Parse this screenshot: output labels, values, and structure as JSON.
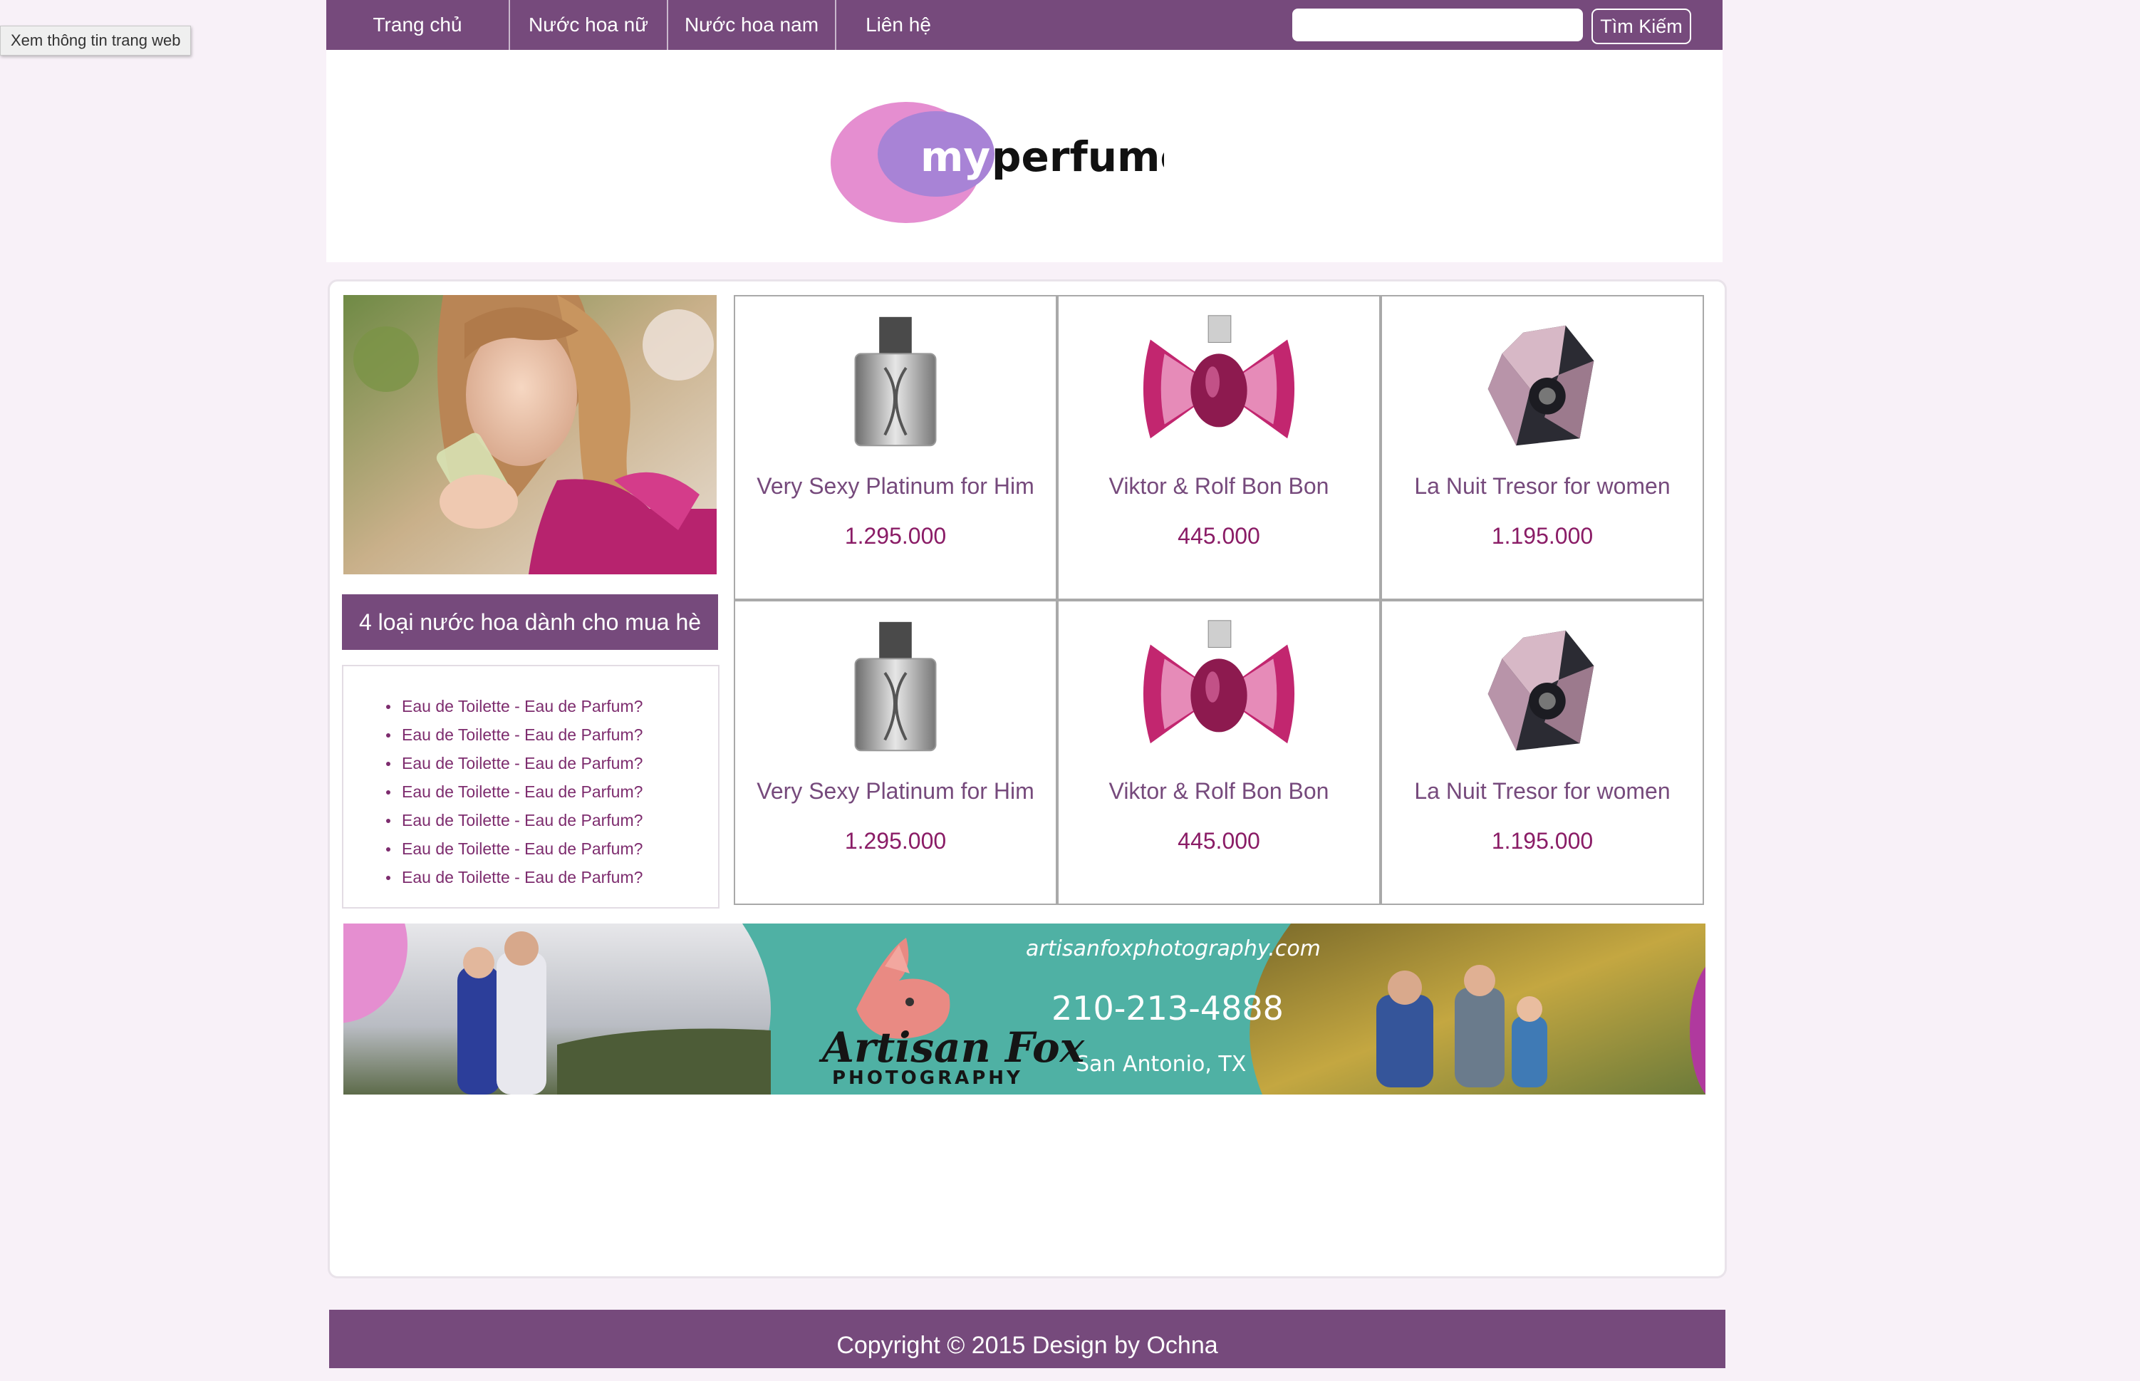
{
  "tooltip": "Xem thông tin trang web",
  "nav": {
    "items": [
      {
        "label": "Trang chủ"
      },
      {
        "label": "Nước hoa nữ"
      },
      {
        "label": "Nước hoa nam"
      },
      {
        "label": "Liên hệ"
      }
    ],
    "search_placeholder": "",
    "search_button": "Tìm Kiếm"
  },
  "header": {
    "logo_my": "my",
    "logo_perfume": "perfume"
  },
  "sidebar": {
    "title": "4 loại nước hoa dành cho mua hè",
    "links": [
      "Eau de Toilette - Eau de Parfum?",
      "Eau de Toilette - Eau de Parfum?",
      "Eau de Toilette - Eau de Parfum?",
      "Eau de Toilette - Eau de Parfum?",
      "Eau de Toilette - Eau de Parfum?",
      "Eau de Toilette - Eau de Parfum?",
      "Eau de Toilette - Eau de Parfum?"
    ]
  },
  "products": [
    {
      "name": "Very Sexy Platinum for Him",
      "price": "1.295.000",
      "image": "platinum-bottle"
    },
    {
      "name": "Viktor & Rolf Bon Bon",
      "price": "445.000",
      "image": "bow-bottle"
    },
    {
      "name": "La Nuit Tresor for women",
      "price": "1.195.000",
      "image": "diamond-bottle"
    },
    {
      "name": "Very Sexy Platinum for Him",
      "price": "1.295.000",
      "image": "platinum-bottle"
    },
    {
      "name": "Viktor & Rolf Bon Bon",
      "price": "445.000",
      "image": "bow-bottle"
    },
    {
      "name": "La Nuit Tresor for women",
      "price": "1.195.000",
      "image": "diamond-bottle"
    }
  ],
  "banner": {
    "website": "artisanfoxphotography.com",
    "phone": "210-213-4888",
    "location": "San Antonio, TX",
    "brand": "Artisan Fox",
    "brand_sub": "PHOTOGRAPHY"
  },
  "footer": {
    "text": "Copyright © 2015 Design by Ochna"
  },
  "colors": {
    "brand_purple": "#764a7c",
    "product_title": "#764a7c",
    "price": "#8a1c66",
    "page_bg": "#f8f1f8",
    "banner_teal": "#4fb1a4"
  }
}
